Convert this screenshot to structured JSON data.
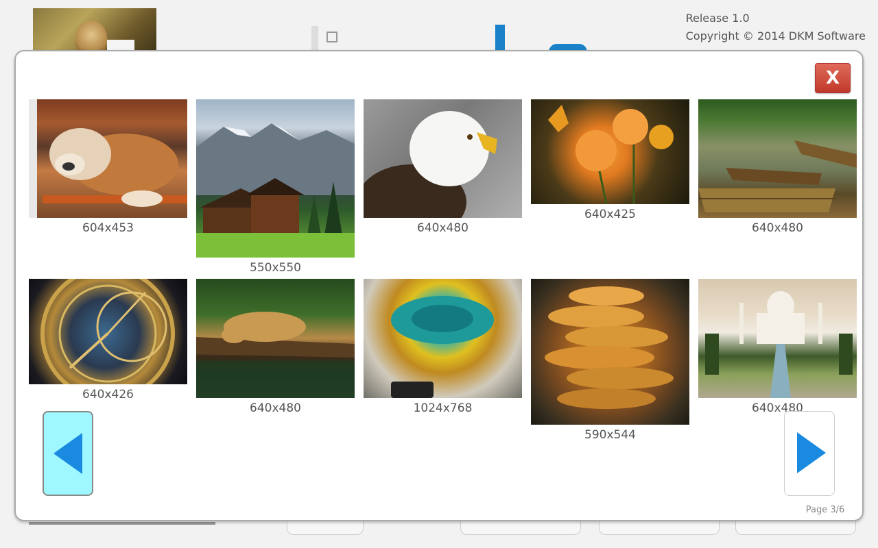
{
  "header": {
    "release": "Release 1.0",
    "copyright": "Copyright © 2014 DKM Software"
  },
  "gallery": {
    "close_label": "X",
    "page_label": "Page 3/6",
    "items": [
      {
        "caption": "604x453",
        "icon": "bulldog-image"
      },
      {
        "caption": "550x550",
        "icon": "mountain-chalet-image"
      },
      {
        "caption": "640x480",
        "icon": "bald-eagle-image"
      },
      {
        "caption": "640x425",
        "icon": "butterfly-flowers-image"
      },
      {
        "caption": "640x480",
        "icon": "river-boats-image"
      },
      {
        "caption": "640x426",
        "icon": "astronomical-clock-image"
      },
      {
        "caption": "640x480",
        "icon": "jaguar-jungle-image"
      },
      {
        "caption": "1024x768",
        "icon": "hot-spring-image"
      },
      {
        "caption": "590x544",
        "icon": "mushrooms-image"
      },
      {
        "caption": "640x480",
        "icon": "taj-mahal-image"
      }
    ]
  },
  "colors": {
    "prev_button": "#9ff7ff",
    "arrow": "#1a8ae0",
    "close_button": "#c0392b"
  }
}
